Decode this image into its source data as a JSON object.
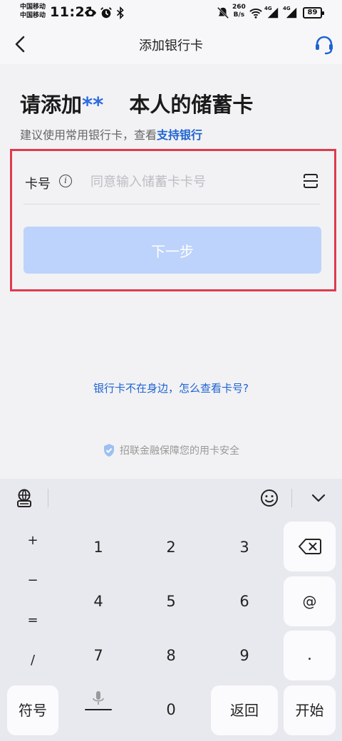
{
  "status_bar": {
    "carrier_1": "中国移动",
    "carrier_2": "中国移动",
    "time": "11:21",
    "net_speed_value": "260",
    "net_speed_unit": "B/s",
    "signal_1": "4G",
    "signal_2": "4G",
    "battery": "89"
  },
  "header": {
    "title": "添加银行卡"
  },
  "page": {
    "headline_prefix": "请添加",
    "headline_mask": "**",
    "headline_suffix": "本人的储蓄卡",
    "subline_text": "建议使用常用银行卡，查看",
    "subline_link": "支持银行"
  },
  "form": {
    "card_label": "卡号",
    "info_icon_glyph": "i",
    "card_placeholder": "同意输入储蓄卡卡号",
    "card_value": "",
    "next_label": "下一步"
  },
  "links": {
    "no_card": "银行卡不在身边，怎么查看卡号?",
    "security": "招联金融保障您的用卡安全"
  },
  "keyboard": {
    "symbols": [
      "+",
      "−",
      "=",
      "/"
    ],
    "digits": [
      "1",
      "2",
      "3",
      "4",
      "5",
      "6",
      "7",
      "8",
      "9",
      "0"
    ],
    "side_keys": [
      "@",
      "."
    ],
    "symbol_key": "符号",
    "return_key": "返回",
    "start_key": "开始"
  },
  "colors": {
    "accent": "#1f63d2",
    "button_disabled": "#bdd3fb",
    "highlight_border": "#e03a4e"
  }
}
